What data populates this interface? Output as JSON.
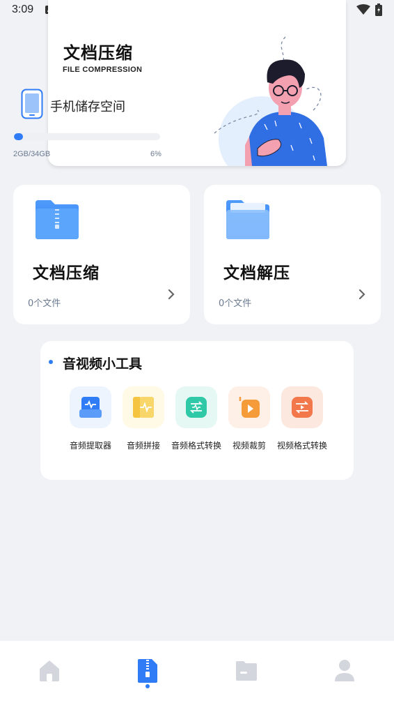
{
  "status_bar": {
    "time": "3:09",
    "notification_icon": "A"
  },
  "hero": {
    "title": "文档压缩",
    "subtitle": "FILE COMPRESSION",
    "storage_label": "手机储存空间",
    "storage_used_text": "2GB/34GB",
    "storage_percent_text": "6%",
    "storage_fraction": 0.06
  },
  "cards": [
    {
      "title": "文档压缩",
      "count": "0个文件",
      "icon": "zip-folder-icon"
    },
    {
      "title": "文档解压",
      "count": "0个文件",
      "icon": "open-folder-icon"
    }
  ],
  "tools": {
    "title": "音视频小工具",
    "items": [
      {
        "label": "音频提取器",
        "icon": "audio-extract-icon",
        "color": "#2f7cf6"
      },
      {
        "label": "音频拼接",
        "icon": "audio-merge-icon",
        "color": "#f5c542"
      },
      {
        "label": "音频格式转换",
        "icon": "audio-convert-icon",
        "color": "#2fc9a7"
      },
      {
        "label": "视频裁剪",
        "icon": "video-trim-icon",
        "color": "#f59b3a"
      },
      {
        "label": "视频格式转换",
        "icon": "video-convert-icon",
        "color": "#f2784b"
      }
    ]
  },
  "bottom_nav": {
    "items": [
      {
        "name": "home",
        "icon": "home-icon"
      },
      {
        "name": "compress",
        "icon": "zip-document-icon",
        "active": true
      },
      {
        "name": "files",
        "icon": "folder-icon"
      },
      {
        "name": "profile",
        "icon": "user-icon"
      }
    ]
  },
  "colors": {
    "accent": "#2f7cf6",
    "background": "#f1f2f6",
    "muted_text": "#6b7a90"
  }
}
